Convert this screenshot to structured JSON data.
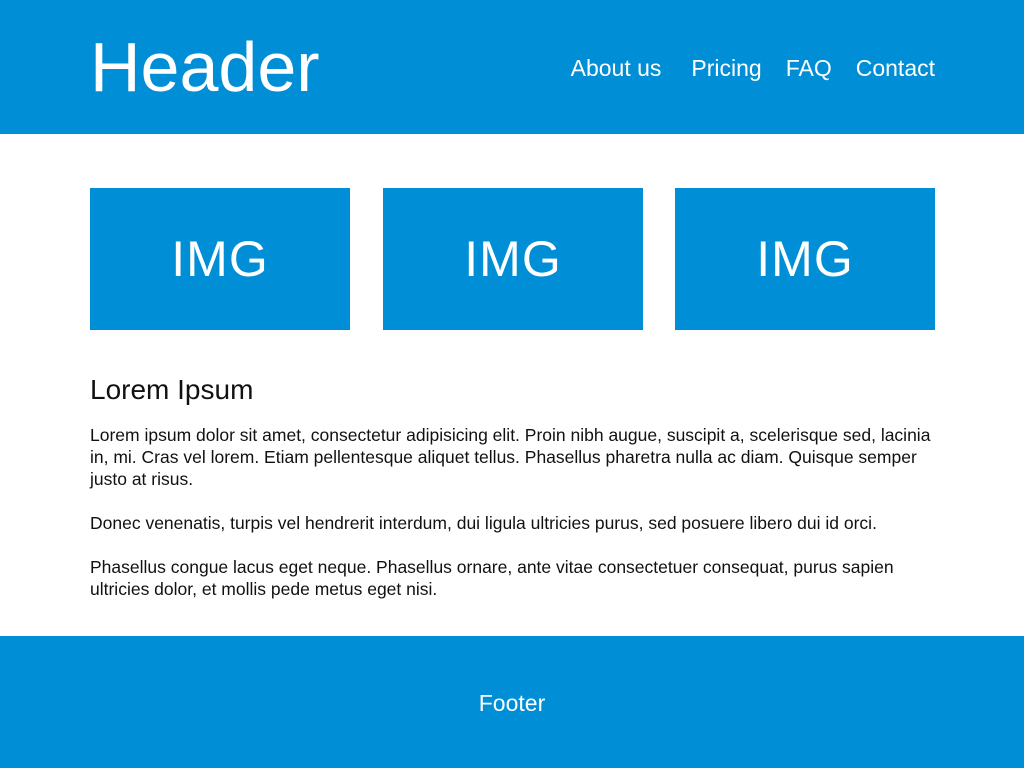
{
  "header": {
    "title": "Header",
    "nav": [
      {
        "label": "About us"
      },
      {
        "label": "Pricing"
      },
      {
        "label": "FAQ"
      },
      {
        "label": "Contact"
      }
    ]
  },
  "images": [
    {
      "label": "IMG"
    },
    {
      "label": "IMG"
    },
    {
      "label": "IMG"
    }
  ],
  "content": {
    "title": "Lorem Ipsum",
    "paragraphs": [
      "Lorem ipsum dolor sit amet, consectetur adipisicing elit. Proin nibh augue, suscipit a, scelerisque sed, lacinia in, mi. Cras vel lorem. Etiam pellentesque aliquet tellus. Phasellus pharetra nulla ac diam. Quisque semper justo at risus.",
      "Donec venenatis, turpis vel hendrerit interdum, dui ligula ultricies purus, sed posuere libero dui id orci.",
      "Phasellus congue lacus eget neque. Phasellus ornare, ante vitae consectetuer consequat, purus sapien ultricies dolor, et mollis pede metus eget nisi."
    ]
  },
  "footer": {
    "label": "Footer"
  },
  "colors": {
    "brand_blue": "#008fd6",
    "text_white": "#ffffff",
    "body_text": "#111111"
  }
}
